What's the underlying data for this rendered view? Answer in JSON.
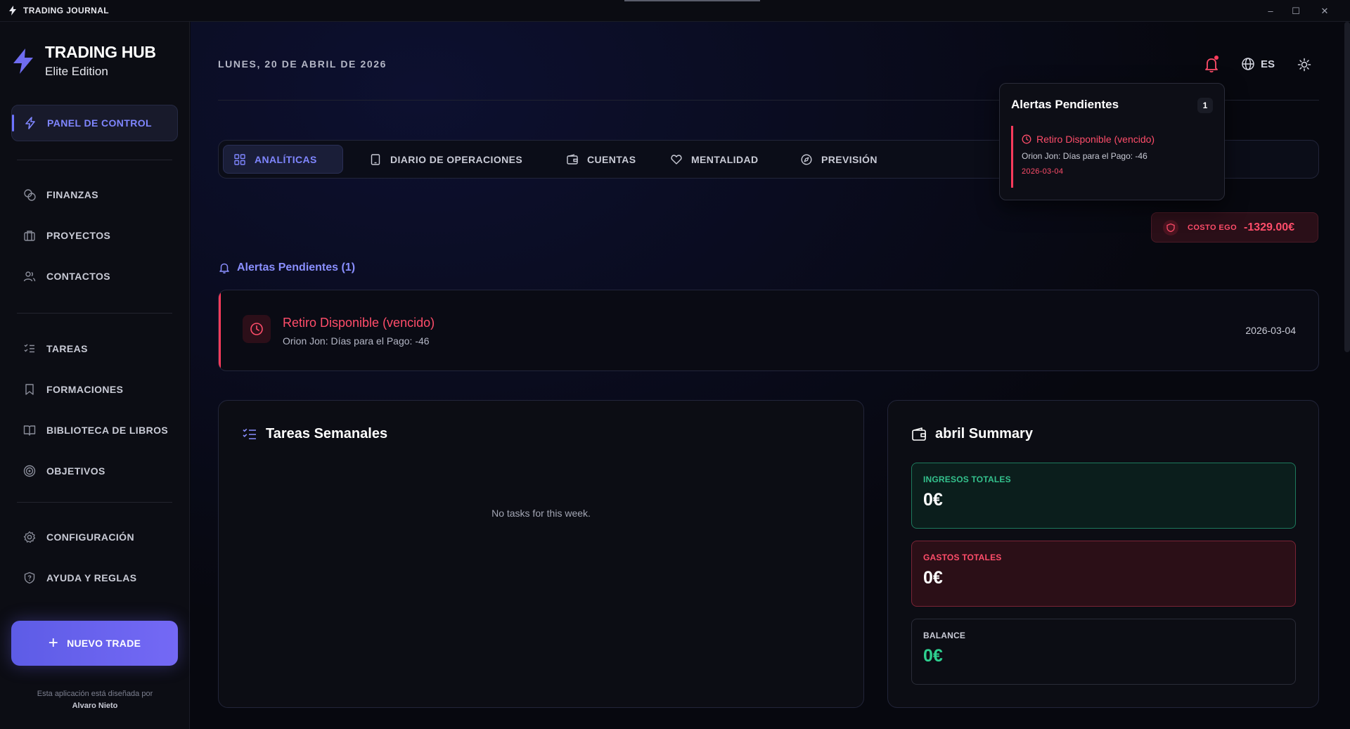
{
  "window": {
    "title": "TRADING JOURNAL",
    "controls": [
      "–",
      "☐",
      "✕"
    ]
  },
  "sidebar": {
    "brand": {
      "title": "TRADING HUB",
      "subtitle": "Elite Edition"
    },
    "items": [
      {
        "label": "PANEL DE CONTROL",
        "icon": "bolt-icon",
        "active": true
      },
      {
        "label": "FINANZAS",
        "icon": "coins-icon"
      },
      {
        "label": "PROYECTOS",
        "icon": "briefcase-icon"
      },
      {
        "label": "CONTACTOS",
        "icon": "users-icon"
      },
      {
        "label": "TAREAS",
        "icon": "list-check-icon"
      },
      {
        "label": "FORMACIONES",
        "icon": "bookmark-icon"
      },
      {
        "label": "BIBLIOTECA DE LIBROS",
        "icon": "book-open-icon"
      },
      {
        "label": "OBJETIVOS",
        "icon": "target-icon"
      },
      {
        "label": "CONFIGURACIÓN",
        "icon": "gear-icon"
      },
      {
        "label": "AYUDA Y REGLAS",
        "icon": "shield-help-icon"
      }
    ],
    "new_trade_label": "NUEVO TRADE",
    "credit_line": "Esta aplicación está diseñada por",
    "credit_author": "Alvaro Nieto"
  },
  "header": {
    "date": "LUNES, 20 DE ABRIL DE 2026",
    "language": "ES"
  },
  "tabs": [
    {
      "label": "ANALÍTICAS",
      "icon": "grid-icon",
      "active": true
    },
    {
      "label": "DIARIO DE OPERACIONES",
      "icon": "tablet-icon"
    },
    {
      "label": "CUENTAS",
      "icon": "wallet-icon"
    },
    {
      "label": "MENTALIDAD",
      "icon": "heart-icon"
    },
    {
      "label": "PREVISIÓN",
      "icon": "compass-icon"
    }
  ],
  "ego": {
    "label": "COSTO EGO",
    "value": "-1329.00€"
  },
  "alerts": {
    "title": "Alertas Pendientes (1)",
    "item": {
      "title": "Retiro Disponible (vencido)",
      "detail": "Orion Jon: Días para el Pago: -46",
      "date": "2026-03-04"
    }
  },
  "popup": {
    "title": "Alertas Pendientes",
    "count": "1",
    "item": {
      "title": "Retiro Disponible (vencido)",
      "detail": "Orion Jon: Días para el Pago: -46",
      "date": "2026-03-04"
    }
  },
  "tasks_panel": {
    "title": "Tareas Semanales",
    "empty": "No tasks for this week."
  },
  "summary_panel": {
    "title": "abril Summary",
    "income": {
      "label": "INGRESOS TOTALES",
      "value": "0€"
    },
    "expense": {
      "label": "GASTOS TOTALES",
      "value": "0€"
    },
    "balance": {
      "label": "BALANCE",
      "value": "0€"
    }
  },
  "colors": {
    "accent": "#7f86ff",
    "danger": "#ff4d6a",
    "success": "#2ecf8f",
    "background": "#07080f"
  }
}
